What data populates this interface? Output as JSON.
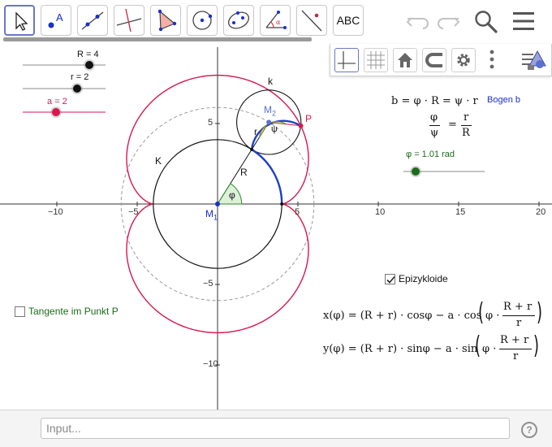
{
  "toolbar": {
    "tools": [
      "move-tool",
      "point-tool",
      "line-tool",
      "perpendicular-tool",
      "polygon-tool",
      "circle-tool",
      "conic-tool",
      "angle-tool",
      "reflect-tool",
      "text-tool"
    ],
    "text_tool_label": "ABC",
    "icons": [
      "undo-icon",
      "redo-icon",
      "search-icon",
      "menu-icon"
    ]
  },
  "stylebar": {
    "buttons": [
      "axes-toggle",
      "grid-toggle",
      "home-view",
      "snap-mode",
      "settings",
      "more-options",
      "graphics-view-menu"
    ]
  },
  "graph": {
    "x_ticks": [
      "−10",
      "−5",
      "5",
      "10",
      "15",
      "20"
    ],
    "y_ticks": [
      "5",
      "−5",
      "−10"
    ],
    "labels": {
      "K": "K",
      "k": "k",
      "M1": "M",
      "M1_sub": "1",
      "M2": "M",
      "M2_sub": "2",
      "P": "P",
      "r": "r",
      "R": "R",
      "phi": "φ",
      "psi": "ψ"
    }
  },
  "sliders": {
    "R": {
      "label": "R = 4",
      "value": 4
    },
    "r": {
      "label": "r = 2",
      "value": 2
    },
    "a": {
      "label": "a = 2",
      "value": 2
    },
    "phi": {
      "label": "φ = 1.01 rad",
      "value": 1.01
    }
  },
  "formulas": {
    "bogen": "b = φ · R = ψ · r",
    "bogen_label": "Bogen b",
    "ratio_top_left": "φ",
    "ratio_bottom_left": "ψ",
    "ratio_equals": "=",
    "ratio_top_right": "r",
    "ratio_bottom_right": "R",
    "x_eq": "x(φ) = (R + r) · cosφ − a · cos",
    "y_eq": "y(φ) = (R + r) · sinφ − a · sin",
    "inner_phi": "φ ·",
    "frac_num": "R + r",
    "frac_den": "r"
  },
  "checkboxes": {
    "epizykloide": {
      "label": "Epizykloide",
      "checked": true
    },
    "tangente": {
      "label": "Tangente im Punkt P",
      "checked": false
    }
  },
  "input": {
    "placeholder": "Input..."
  },
  "colors": {
    "epicycloid": "#d8174f",
    "arc": "#1f3fc8",
    "slider_a": "#d8174f",
    "phi_slider": "#1a6b1a",
    "point_blue": "#1a2fcc",
    "angle_green": "#2f8a2f",
    "bogen_blue": "#1a2fcc",
    "help_gray": "#8f8f8f"
  }
}
